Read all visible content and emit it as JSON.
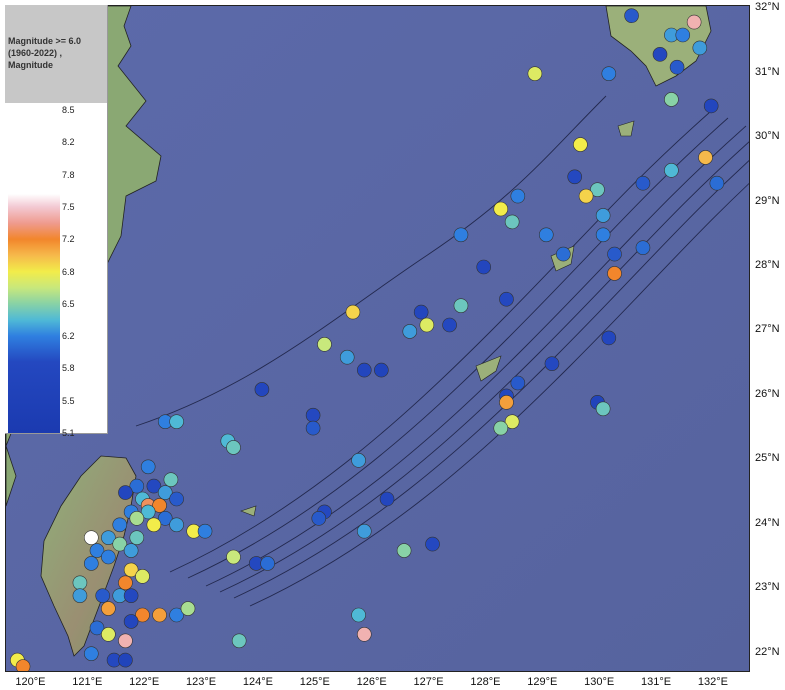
{
  "legend": {
    "title_line1": "Magnitude >= 6.0",
    "title_line2": "(1960-2022) ,",
    "title_line3": "Magnitude",
    "ticks": [
      "8.5",
      "8.2",
      "7.8",
      "7.5",
      "7.2",
      "6.8",
      "6.5",
      "6.2",
      "5.8",
      "5.5",
      "5.1"
    ]
  },
  "axes": {
    "lat_labels": [
      "32°N",
      "31°N",
      "30°N",
      "29°N",
      "28°N",
      "27°N",
      "26°N",
      "25°N",
      "24°N",
      "23°N",
      "22°N"
    ],
    "lon_labels": [
      "120°E",
      "121°E",
      "122°E",
      "123°E",
      "124°E",
      "125°E",
      "126°E",
      "127°E",
      "128°E",
      "129°E",
      "130°E",
      "131°E",
      "132°E"
    ]
  },
  "colors": {
    "sea": "#5a68a8",
    "land": "#8aa873",
    "scale_low": "#1b3ab0",
    "scale_mid": "#88d2a6",
    "scale_high": "#ffffff"
  },
  "events": [
    {
      "lon": 131.6,
      "lat": 31.8,
      "mag": 7.6
    },
    {
      "lon": 130.5,
      "lat": 31.9,
      "mag": 5.9
    },
    {
      "lon": 131.2,
      "lat": 31.6,
      "mag": 6.2
    },
    {
      "lon": 131.0,
      "lat": 31.3,
      "mag": 5.8
    },
    {
      "lon": 131.3,
      "lat": 31.1,
      "mag": 5.9
    },
    {
      "lon": 130.1,
      "lat": 31.0,
      "mag": 6.1
    },
    {
      "lon": 128.8,
      "lat": 31.0,
      "mag": 6.8
    },
    {
      "lon": 131.2,
      "lat": 30.6,
      "mag": 6.5
    },
    {
      "lon": 131.9,
      "lat": 30.5,
      "mag": 5.7
    },
    {
      "lon": 129.6,
      "lat": 29.9,
      "mag": 6.9
    },
    {
      "lon": 131.8,
      "lat": 29.7,
      "mag": 7.1
    },
    {
      "lon": 131.2,
      "lat": 29.5,
      "mag": 6.3
    },
    {
      "lon": 129.5,
      "lat": 29.4,
      "mag": 5.8
    },
    {
      "lon": 130.7,
      "lat": 29.3,
      "mag": 5.9
    },
    {
      "lon": 129.9,
      "lat": 29.2,
      "mag": 6.4
    },
    {
      "lon": 129.7,
      "lat": 29.1,
      "mag": 7.0
    },
    {
      "lon": 128.5,
      "lat": 29.1,
      "mag": 6.1
    },
    {
      "lon": 132.0,
      "lat": 29.3,
      "mag": 6.0
    },
    {
      "lon": 128.2,
      "lat": 28.9,
      "mag": 6.9
    },
    {
      "lon": 128.4,
      "lat": 28.7,
      "mag": 6.4
    },
    {
      "lon": 130.0,
      "lat": 28.8,
      "mag": 6.2
    },
    {
      "lon": 129.0,
      "lat": 28.5,
      "mag": 6.1
    },
    {
      "lon": 130.0,
      "lat": 28.5,
      "mag": 6.1
    },
    {
      "lon": 127.5,
      "lat": 28.5,
      "mag": 6.1
    },
    {
      "lon": 129.3,
      "lat": 28.2,
      "mag": 6.0
    },
    {
      "lon": 130.2,
      "lat": 28.2,
      "mag": 5.9
    },
    {
      "lon": 130.7,
      "lat": 28.3,
      "mag": 6.0
    },
    {
      "lon": 130.2,
      "lat": 27.9,
      "mag": 7.3
    },
    {
      "lon": 127.9,
      "lat": 28.0,
      "mag": 5.7
    },
    {
      "lon": 128.3,
      "lat": 27.5,
      "mag": 5.8
    },
    {
      "lon": 127.5,
      "lat": 27.4,
      "mag": 6.4
    },
    {
      "lon": 126.8,
      "lat": 27.3,
      "mag": 5.7
    },
    {
      "lon": 125.6,
      "lat": 27.3,
      "mag": 7.0
    },
    {
      "lon": 127.3,
      "lat": 27.1,
      "mag": 5.8
    },
    {
      "lon": 126.9,
      "lat": 27.1,
      "mag": 6.8
    },
    {
      "lon": 126.6,
      "lat": 27.0,
      "mag": 6.2
    },
    {
      "lon": 130.1,
      "lat": 26.9,
      "mag": 5.7
    },
    {
      "lon": 125.1,
      "lat": 26.8,
      "mag": 6.7
    },
    {
      "lon": 125.5,
      "lat": 26.6,
      "mag": 6.2
    },
    {
      "lon": 126.1,
      "lat": 26.4,
      "mag": 5.6
    },
    {
      "lon": 125.8,
      "lat": 26.4,
      "mag": 5.7
    },
    {
      "lon": 129.1,
      "lat": 26.5,
      "mag": 5.8
    },
    {
      "lon": 128.5,
      "lat": 26.2,
      "mag": 5.9
    },
    {
      "lon": 128.3,
      "lat": 26.0,
      "mag": 5.8
    },
    {
      "lon": 124.0,
      "lat": 26.1,
      "mag": 5.7
    },
    {
      "lon": 129.9,
      "lat": 25.9,
      "mag": 5.6
    },
    {
      "lon": 128.3,
      "lat": 25.9,
      "mag": 7.2
    },
    {
      "lon": 130.0,
      "lat": 25.8,
      "mag": 6.4
    },
    {
      "lon": 124.9,
      "lat": 25.7,
      "mag": 5.8
    },
    {
      "lon": 128.4,
      "lat": 25.6,
      "mag": 6.8
    },
    {
      "lon": 128.2,
      "lat": 25.5,
      "mag": 6.5
    },
    {
      "lon": 122.3,
      "lat": 25.6,
      "mag": 6.1
    },
    {
      "lon": 122.5,
      "lat": 25.6,
      "mag": 6.3
    },
    {
      "lon": 124.9,
      "lat": 25.5,
      "mag": 5.9
    },
    {
      "lon": 123.4,
      "lat": 25.3,
      "mag": 6.3
    },
    {
      "lon": 123.5,
      "lat": 25.2,
      "mag": 6.4
    },
    {
      "lon": 125.7,
      "lat": 25.0,
      "mag": 6.2
    },
    {
      "lon": 122.0,
      "lat": 24.9,
      "mag": 6.1
    },
    {
      "lon": 122.4,
      "lat": 24.7,
      "mag": 6.4
    },
    {
      "lon": 121.8,
      "lat": 24.6,
      "mag": 6.0
    },
    {
      "lon": 122.1,
      "lat": 24.6,
      "mag": 5.8
    },
    {
      "lon": 122.3,
      "lat": 24.5,
      "mag": 6.2
    },
    {
      "lon": 121.6,
      "lat": 24.5,
      "mag": 5.7
    },
    {
      "lon": 121.9,
      "lat": 24.4,
      "mag": 6.3
    },
    {
      "lon": 122.0,
      "lat": 24.3,
      "mag": 7.4
    },
    {
      "lon": 122.2,
      "lat": 24.3,
      "mag": 7.3
    },
    {
      "lon": 122.5,
      "lat": 24.4,
      "mag": 5.9
    },
    {
      "lon": 126.2,
      "lat": 24.4,
      "mag": 5.7
    },
    {
      "lon": 125.1,
      "lat": 24.2,
      "mag": 5.8
    },
    {
      "lon": 125.0,
      "lat": 24.1,
      "mag": 5.9
    },
    {
      "lon": 121.7,
      "lat": 24.2,
      "mag": 6.1
    },
    {
      "lon": 122.0,
      "lat": 24.2,
      "mag": 6.3
    },
    {
      "lon": 121.8,
      "lat": 24.1,
      "mag": 6.6
    },
    {
      "lon": 122.3,
      "lat": 24.1,
      "mag": 6.0
    },
    {
      "lon": 121.5,
      "lat": 24.0,
      "mag": 6.1
    },
    {
      "lon": 122.1,
      "lat": 24.0,
      "mag": 6.9
    },
    {
      "lon": 122.5,
      "lat": 24.0,
      "mag": 6.2
    },
    {
      "lon": 122.8,
      "lat": 23.9,
      "mag": 6.9
    },
    {
      "lon": 123.0,
      "lat": 23.9,
      "mag": 6.1
    },
    {
      "lon": 125.8,
      "lat": 23.9,
      "mag": 6.2
    },
    {
      "lon": 121.8,
      "lat": 23.8,
      "mag": 6.4
    },
    {
      "lon": 121.3,
      "lat": 23.8,
      "mag": 6.2
    },
    {
      "lon": 121.0,
      "lat": 23.8,
      "mag": 8.0
    },
    {
      "lon": 121.5,
      "lat": 23.7,
      "mag": 6.5
    },
    {
      "lon": 121.1,
      "lat": 23.6,
      "mag": 6.1
    },
    {
      "lon": 121.3,
      "lat": 23.5,
      "mag": 6.1
    },
    {
      "lon": 121.7,
      "lat": 23.6,
      "mag": 6.2
    },
    {
      "lon": 127.0,
      "lat": 23.7,
      "mag": 5.8
    },
    {
      "lon": 126.5,
      "lat": 23.6,
      "mag": 6.5
    },
    {
      "lon": 123.5,
      "lat": 23.5,
      "mag": 6.7
    },
    {
      "lon": 123.9,
      "lat": 23.4,
      "mag": 5.8
    },
    {
      "lon": 124.1,
      "lat": 23.4,
      "mag": 6.0
    },
    {
      "lon": 121.0,
      "lat": 23.4,
      "mag": 6.1
    },
    {
      "lon": 121.7,
      "lat": 23.3,
      "mag": 7.0
    },
    {
      "lon": 121.9,
      "lat": 23.2,
      "mag": 6.8
    },
    {
      "lon": 120.8,
      "lat": 23.1,
      "mag": 6.4
    },
    {
      "lon": 121.6,
      "lat": 23.1,
      "mag": 7.3
    },
    {
      "lon": 120.8,
      "lat": 22.9,
      "mag": 6.2
    },
    {
      "lon": 121.2,
      "lat": 22.9,
      "mag": 5.9
    },
    {
      "lon": 121.5,
      "lat": 22.9,
      "mag": 6.2
    },
    {
      "lon": 121.7,
      "lat": 22.9,
      "mag": 5.8
    },
    {
      "lon": 121.3,
      "lat": 22.7,
      "mag": 7.2
    },
    {
      "lon": 121.9,
      "lat": 22.6,
      "mag": 7.3
    },
    {
      "lon": 122.2,
      "lat": 22.6,
      "mag": 7.2
    },
    {
      "lon": 122.5,
      "lat": 22.6,
      "mag": 6.1
    },
    {
      "lon": 122.7,
      "lat": 22.7,
      "mag": 6.6
    },
    {
      "lon": 121.7,
      "lat": 22.5,
      "mag": 5.7
    },
    {
      "lon": 125.7,
      "lat": 22.6,
      "mag": 6.3
    },
    {
      "lon": 121.1,
      "lat": 22.4,
      "mag": 6.0
    },
    {
      "lon": 121.3,
      "lat": 22.3,
      "mag": 6.8
    },
    {
      "lon": 121.6,
      "lat": 22.2,
      "mag": 7.6
    },
    {
      "lon": 125.8,
      "lat": 22.3,
      "mag": 7.6
    },
    {
      "lon": 123.6,
      "lat": 22.2,
      "mag": 6.4
    },
    {
      "lon": 121.0,
      "lat": 22.0,
      "mag": 6.1
    },
    {
      "lon": 121.4,
      "lat": 21.9,
      "mag": 5.8
    },
    {
      "lon": 121.6,
      "lat": 21.9,
      "mag": 5.6
    },
    {
      "lon": 119.7,
      "lat": 21.9,
      "mag": 6.9
    },
    {
      "lon": 119.8,
      "lat": 21.8,
      "mag": 7.3
    },
    {
      "lon": 131.4,
      "lat": 31.6,
      "mag": 6.1
    },
    {
      "lon": 131.7,
      "lat": 31.4,
      "mag": 6.2
    }
  ]
}
